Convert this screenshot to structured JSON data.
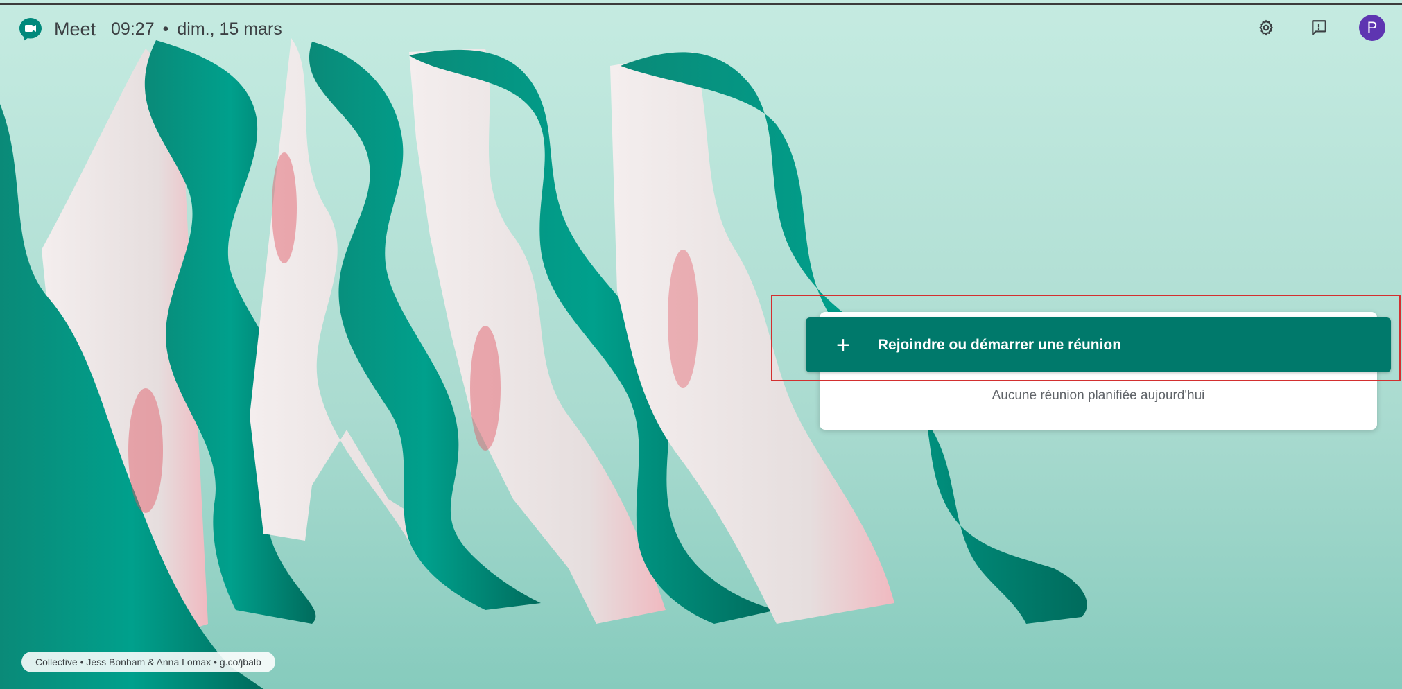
{
  "header": {
    "app_name": "Meet",
    "time": "09:27",
    "separator": "•",
    "date": "dim., 15 mars"
  },
  "toolbar": {
    "settings_icon": "gear-icon",
    "feedback_icon": "feedback-icon",
    "avatar_initial": "P"
  },
  "meeting": {
    "join_plus": "+",
    "join_label": "Rejoindre ou démarrer une réunion",
    "no_meetings": "Aucune réunion planifiée aujourd'hui"
  },
  "background_credit": "Collective • Jess Bonham & Anna Lomax • g.co/jbalb",
  "colors": {
    "accent": "#00796b",
    "avatar": "#5e35b1",
    "background": "#bfe6dc",
    "highlight": "#d32f2f"
  }
}
